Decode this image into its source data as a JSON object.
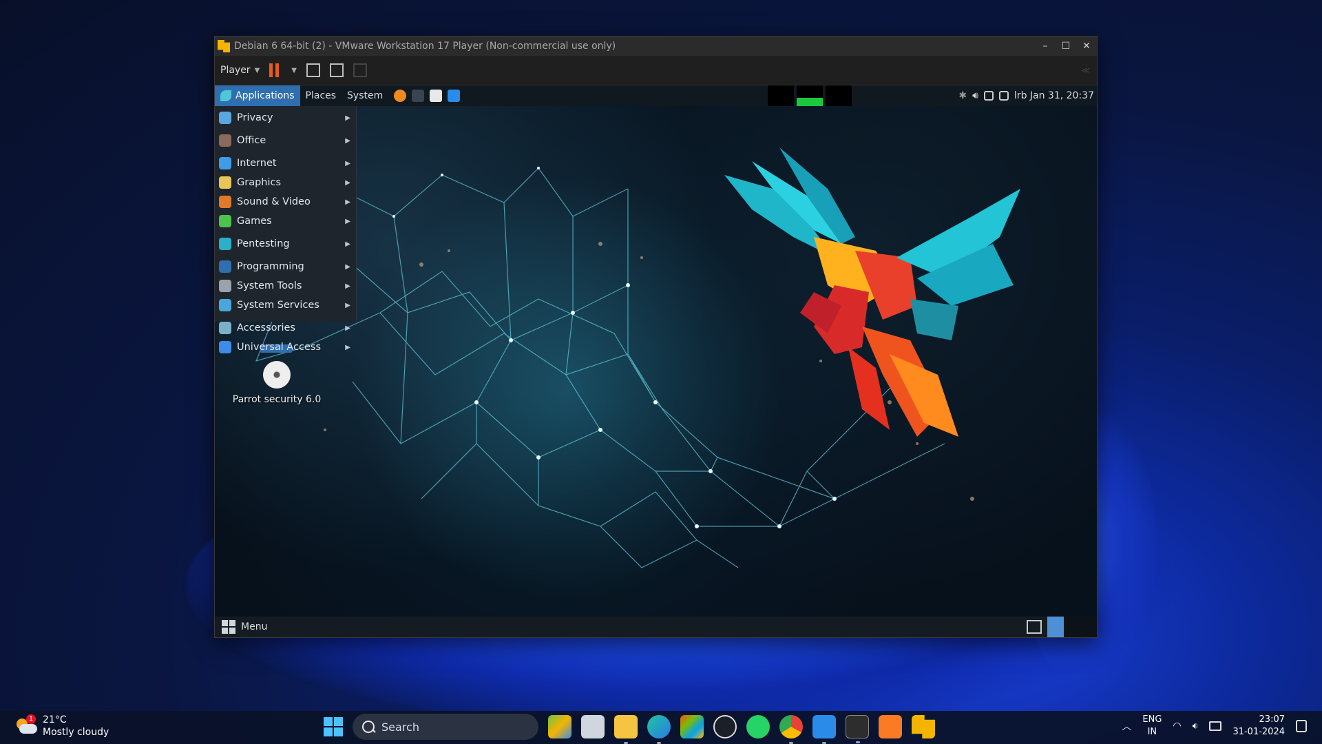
{
  "vmware": {
    "title": "Debian 6 64-bit (2) - VMware Workstation 17 Player (Non-commercial use only)",
    "player_label": "Player",
    "window_controls": {
      "minimize": "–",
      "maximize": "☐",
      "close": "✕"
    }
  },
  "guest": {
    "topbar": {
      "applications": "Applications",
      "places": "Places",
      "system": "System",
      "clock": "lrb Jan 31, 20:37"
    },
    "app_menu": [
      {
        "label": "Privacy",
        "icon": "privacy-icon",
        "color": "#5aa6e0"
      },
      {
        "label": "Office",
        "icon": "office-icon",
        "color": "#8a6a5a"
      },
      {
        "label": "Internet",
        "icon": "internet-icon",
        "color": "#3c9ce8"
      },
      {
        "label": "Graphics",
        "icon": "graphics-icon",
        "color": "#e8c55a"
      },
      {
        "label": "Sound & Video",
        "icon": "sound-video-icon",
        "color": "#e07a2a"
      },
      {
        "label": "Games",
        "icon": "games-icon",
        "color": "#4cc24c"
      },
      {
        "label": "Pentesting",
        "icon": "pentesting-icon",
        "color": "#2ab0c8"
      },
      {
        "label": "Programming",
        "icon": "programming-icon",
        "color": "#2f6fb0"
      },
      {
        "label": "System Tools",
        "icon": "system-tools-icon",
        "color": "#9aa3ad"
      },
      {
        "label": "System Services",
        "icon": "system-services-icon",
        "color": "#4aa6d8"
      },
      {
        "label": "Accessories",
        "icon": "accessories-icon",
        "color": "#7ab0c8"
      },
      {
        "label": "Universal Access",
        "icon": "universal-access-icon",
        "color": "#3c8ce8"
      }
    ],
    "desktop_icon_label": "Parrot security 6.0",
    "bottombar": {
      "menu_label": "Menu"
    }
  },
  "taskbar": {
    "weather_temp": "21°C",
    "weather_desc": "Mostly cloudy",
    "weather_badge": "1",
    "search_placeholder": "Search",
    "lang_line1": "ENG",
    "lang_line2": "IN",
    "time": "23:07",
    "date": "31-01-2024"
  },
  "colors": {
    "accent_blue": "#2f6fb0",
    "pause_orange": "#e85a1c",
    "win_accent": "#4cc2ff"
  }
}
